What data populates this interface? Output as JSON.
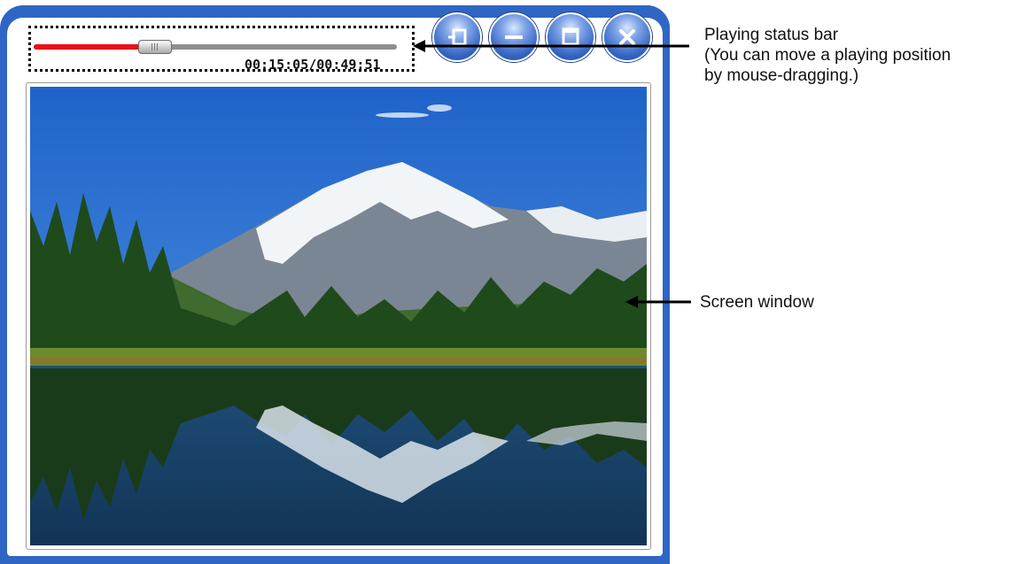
{
  "window": {
    "controls": [
      {
        "name": "compact-mode-button",
        "icon": "compact-mode-icon"
      },
      {
        "name": "minimize-button",
        "icon": "minimize-icon"
      },
      {
        "name": "maximize-button",
        "icon": "maximize-icon"
      },
      {
        "name": "close-button",
        "icon": "close-icon"
      }
    ],
    "accent_color": "#2f66c4"
  },
  "status_bar": {
    "elapsed": "00:15:05",
    "total": "00:49:51",
    "time_text": "00:15:05/00:49:51",
    "progress_fraction": 0.302,
    "played_color": "#e8101a",
    "track_color": "#8f8f8f"
  },
  "screen": {
    "content": "mountain-lake-landscape-image"
  },
  "callouts": {
    "status_bar": {
      "line1": "Playing status bar",
      "line2": "(You can move a playing position",
      "line3": "by mouse-dragging.)"
    },
    "screen": {
      "line1": "Screen window"
    }
  }
}
